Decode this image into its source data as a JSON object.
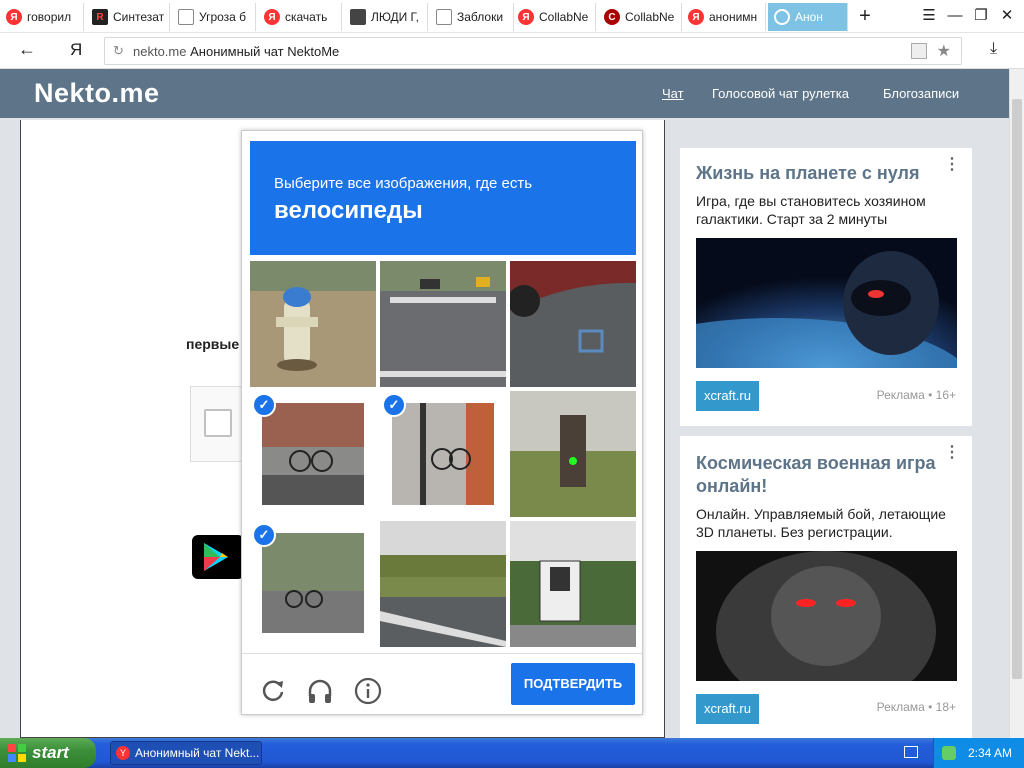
{
  "browser": {
    "tabs": [
      {
        "label": "говорил",
        "favicon": "yandex-icon"
      },
      {
        "label": "Синтезат",
        "favicon": "rs-icon"
      },
      {
        "label": "Угроза б",
        "favicon": "document-icon"
      },
      {
        "label": "скачать",
        "favicon": "yandex-icon"
      },
      {
        "label": "ЛЮДИ Г,",
        "favicon": "people-icon"
      },
      {
        "label": "Заблоки",
        "favicon": "document-icon"
      },
      {
        "label": "CollabNe",
        "favicon": "yandex-icon"
      },
      {
        "label": "CollabNe",
        "favicon": "collabnet-icon"
      },
      {
        "label": "анонимн",
        "favicon": "yandex-icon"
      },
      {
        "label": "Анон",
        "favicon": "nekto-icon",
        "active": true
      }
    ],
    "new_tab": "+",
    "address": {
      "domain": "nekto.me",
      "title": "Анонимный чат NektoMe"
    },
    "yandex_letter": "Я"
  },
  "site": {
    "logo": "Nekto.me",
    "nav": [
      "Чат",
      "Голосовой чат рулетка",
      "Блогозаписи"
    ]
  },
  "background": {
    "partial_text": "первые"
  },
  "captcha": {
    "instruction": "Выберите все изображения, где есть",
    "object": "велосипеды",
    "tiles": [
      {
        "scene": "fire hydrant",
        "selected": false
      },
      {
        "scene": "street crosswalk",
        "selected": false
      },
      {
        "scene": "parking lot",
        "selected": false
      },
      {
        "scene": "bicycle on rack",
        "selected": true
      },
      {
        "scene": "bicycles at pole",
        "selected": true
      },
      {
        "scene": "traffic light",
        "selected": false
      },
      {
        "scene": "cyclist on street",
        "selected": true
      },
      {
        "scene": "highway",
        "selected": false
      },
      {
        "scene": "photo enforced sign",
        "selected": false
      }
    ],
    "confirm_label": "ПОДТВЕРДИТЬ"
  },
  "ads": [
    {
      "title": "Жизнь на планете с нуля",
      "text": "Игра, где вы становитесь хозяином галактики. Старт за 2 минуты",
      "button": "xcraft.ru",
      "meta": "Реклама • 16+"
    },
    {
      "title": "Космическая военная игра онлайн!",
      "text": "Онлайн. Управляемый бой, летающие 3D планеты. Без регистрации.",
      "button": "xcraft.ru",
      "meta": "Реклама • 18+"
    }
  ],
  "taskbar": {
    "start": "start",
    "task": "Анонимный чат Nekt...",
    "clock": "2:34 AM"
  },
  "colors": {
    "header": "#5e7489",
    "captcha_blue": "#1a73e8",
    "ad_button": "#3399cc"
  }
}
